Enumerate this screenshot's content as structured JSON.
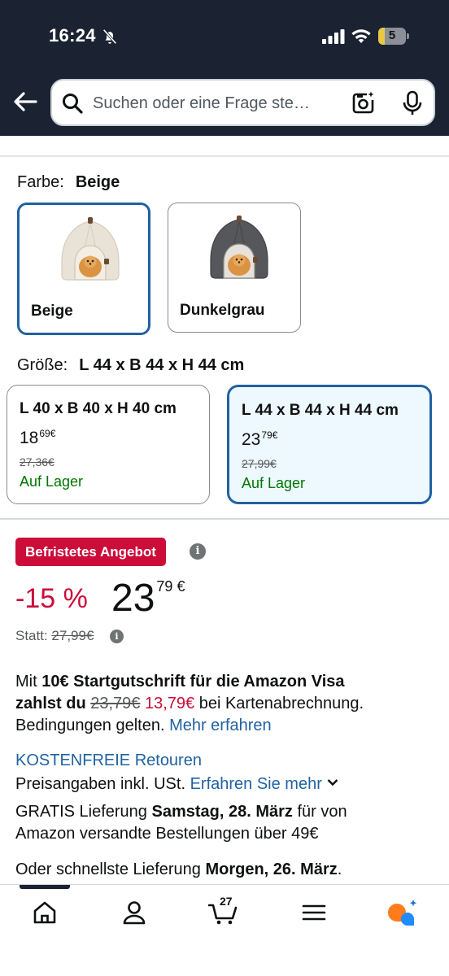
{
  "status": {
    "time": "16:24",
    "battery": "5"
  },
  "header": {
    "search_placeholder": "Suchen oder eine Frage ste…"
  },
  "color_picker": {
    "label": "Farbe:",
    "selected": "Beige",
    "options": [
      {
        "name": "Beige",
        "selected": true
      },
      {
        "name": "Dunkelgrau",
        "selected": false
      }
    ]
  },
  "size_picker": {
    "label": "Größe:",
    "selected": "L 44 x B 44 x H 44 cm",
    "options": [
      {
        "title": "L 40 x B 40 x H 40 cm",
        "price_whole": "18",
        "price_frac": "69",
        "currency": "€",
        "old_price": "27,36€",
        "stock": "Auf Lager",
        "selected": false
      },
      {
        "title": "L 44 x B 44 x H 44 cm",
        "price_whole": "23",
        "price_frac": "79",
        "currency": "€",
        "old_price": "27,99€",
        "stock": "Auf Lager",
        "selected": true
      }
    ]
  },
  "deal": {
    "badge": "Befristetes Angebot",
    "info_glyph": "i",
    "discount": "-15 %",
    "price_whole": "23",
    "price_frac": "79",
    "currency": "€",
    "statt_label": "Statt:",
    "statt_price": "27,99€"
  },
  "visa": {
    "prefix": "Mit ",
    "bold1": "10€ Startgutschrift für die Amazon Visa",
    "bold2": "zahlst du",
    "old_price": "23,79€",
    "new_price": "13,79€",
    "suffix": " bei Kartenabrechnung.",
    "line3": "Bedingungen gelten.",
    "link": "Mehr erfahren"
  },
  "returns": {
    "link": "KOSTENFREIE Retouren"
  },
  "tax": {
    "text": "Preisangaben inkl. USt.",
    "link": "Erfahren Sie mehr"
  },
  "delivery": {
    "pre": "GRATIS Lieferung ",
    "date": "Samstag, 28. März",
    "post": " für von",
    "line2": "Amazon versandte Bestellungen über 49€"
  },
  "fastest": {
    "pre": "Oder schnellste Lieferung ",
    "date": "Morgen, 26. März",
    "post": "."
  },
  "bottom_nav": {
    "items": [
      "home-icon",
      "account-icon",
      "cart-icon",
      "menu-icon",
      "rufus-icon"
    ],
    "cart_count": "27"
  },
  "colors": {
    "header_bg": "#1b2332",
    "deal_red": "#cc0c39",
    "link_blue": "#2162a1",
    "stock_green": "#007600",
    "selected_border": "#2162a1"
  }
}
